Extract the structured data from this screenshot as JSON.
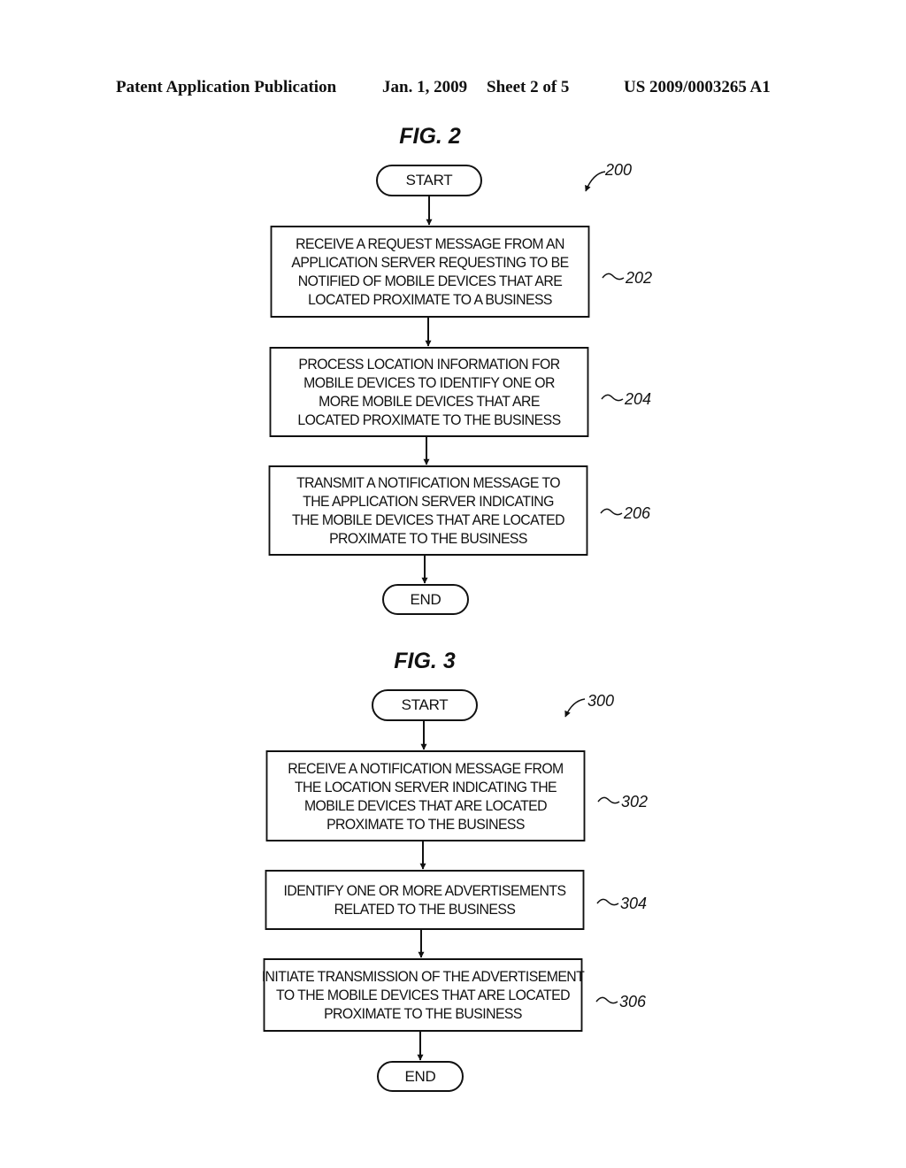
{
  "header": {
    "left": "Patent Application Publication",
    "date": "Jan. 1, 2009",
    "sheet": "Sheet 2 of 5",
    "number": "US 2009/0003265 A1"
  },
  "figures": [
    {
      "title": "FIG. 2",
      "ref": "200",
      "start": "START",
      "end": "END",
      "steps": [
        {
          "ref": "202",
          "lines": [
            "RECEIVE A REQUEST MESSAGE FROM AN",
            "APPLICATION SERVER REQUESTING TO BE",
            "NOTIFIED OF MOBILE DEVICES THAT ARE",
            "LOCATED PROXIMATE TO A BUSINESS"
          ]
        },
        {
          "ref": "204",
          "lines": [
            "PROCESS LOCATION INFORMATION FOR",
            "MOBILE DEVICES TO IDENTIFY ONE OR",
            "MORE MOBILE DEVICES THAT ARE",
            "LOCATED PROXIMATE TO THE BUSINESS"
          ]
        },
        {
          "ref": "206",
          "lines": [
            "TRANSMIT A NOTIFICATION MESSAGE TO",
            "THE APPLICATION SERVER INDICATING",
            "THE MOBILE DEVICES THAT ARE LOCATED",
            "PROXIMATE TO THE BUSINESS"
          ]
        }
      ]
    },
    {
      "title": "FIG. 3",
      "ref": "300",
      "start": "START",
      "end": "END",
      "steps": [
        {
          "ref": "302",
          "lines": [
            "RECEIVE A NOTIFICATION MESSAGE FROM",
            "THE LOCATION SERVER INDICATING THE",
            "MOBILE DEVICES THAT ARE LOCATED",
            "PROXIMATE TO THE BUSINESS"
          ]
        },
        {
          "ref": "304",
          "lines": [
            "IDENTIFY ONE OR MORE ADVERTISEMENTS",
            "RELATED TO THE BUSINESS"
          ]
        },
        {
          "ref": "306",
          "lines": [
            "INITIATE TRANSMISSION OF THE ADVERTISEMENT",
            "TO THE MOBILE DEVICES THAT ARE LOCATED",
            "PROXIMATE TO THE BUSINESS"
          ]
        }
      ]
    }
  ]
}
